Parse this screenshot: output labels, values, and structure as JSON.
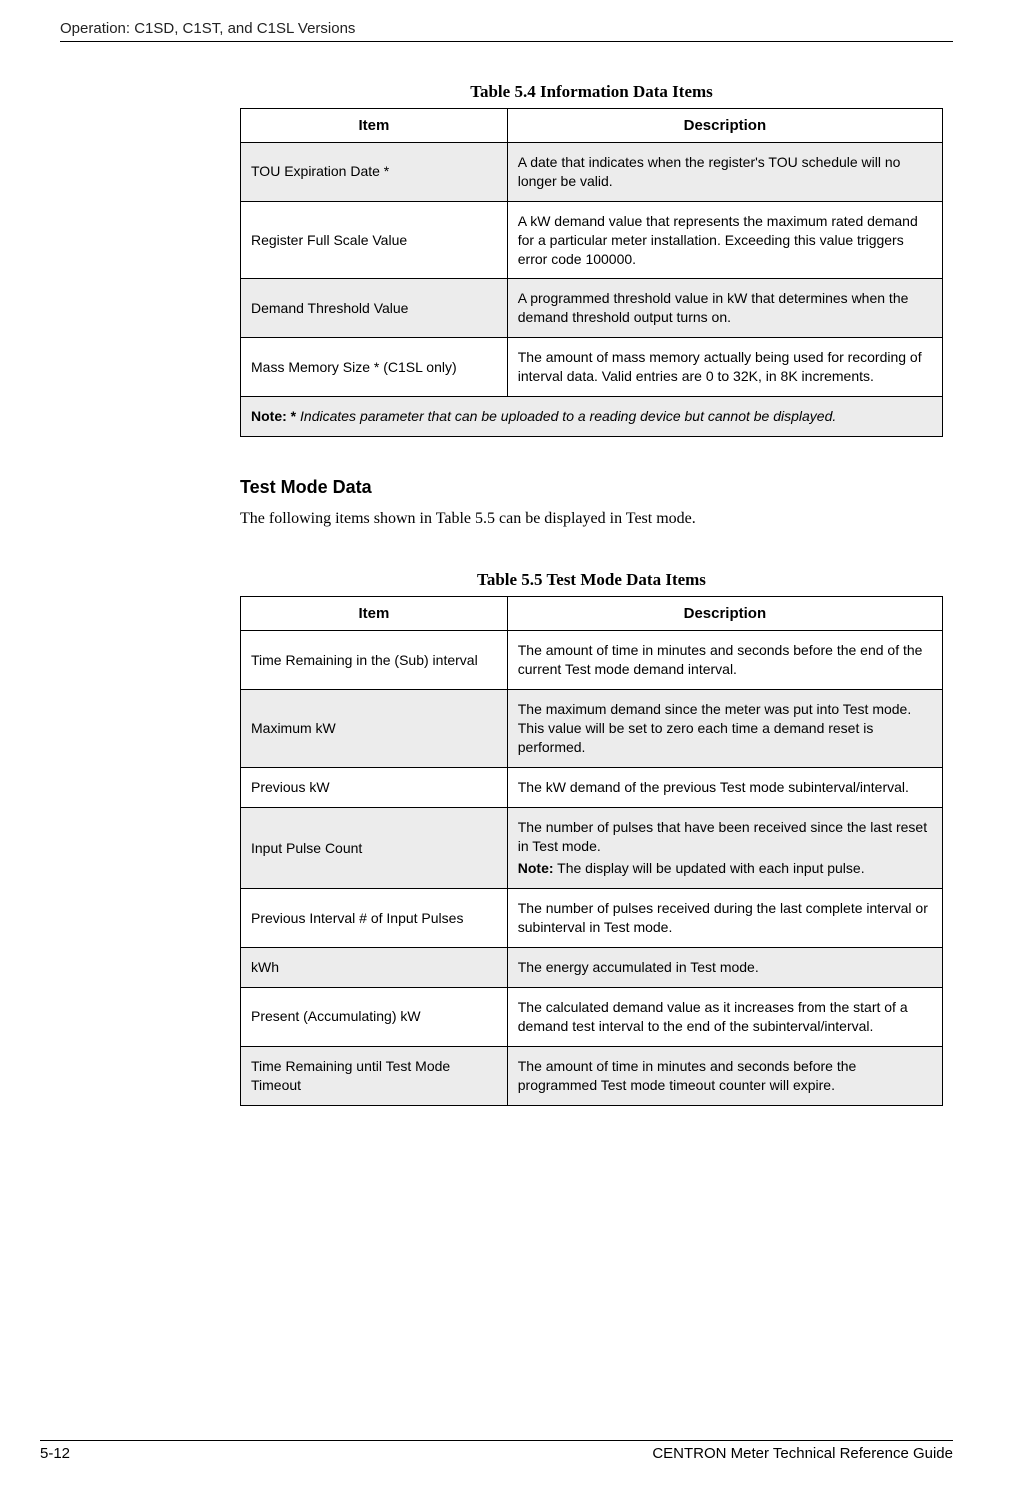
{
  "header": "Operation: C1SD, C1ST, and C1SL Versions",
  "table54": {
    "caption": "Table 5.4 Information Data Items",
    "headers": {
      "item": "Item",
      "desc": "Description"
    },
    "rows": [
      {
        "item": "TOU Expiration Date *",
        "desc": "A date that indicates when the register's TOU schedule will no longer be valid."
      },
      {
        "item": "Register Full Scale Value",
        "desc": "A kW demand value that represents the maximum rated demand for a particular meter installation. Exceeding this value triggers error code 100000."
      },
      {
        "item": "Demand Threshold Value",
        "desc": "A programmed threshold value in kW that determines when the demand threshold output turns on."
      },
      {
        "item": "Mass Memory Size * (C1SL only)",
        "desc": "The amount of mass memory actually being used for recording of interval data. Valid entries are 0 to 32K, in 8K increments."
      }
    ],
    "note_label": "Note: *",
    "note_text": " Indicates parameter that can be uploaded to a reading device but cannot be displayed."
  },
  "section": {
    "heading": "Test Mode Data",
    "body": "The following items shown in Table 5.5 can be displayed in Test mode."
  },
  "table55": {
    "caption": "Table 5.5 Test Mode Data Items",
    "headers": {
      "item": "Item",
      "desc": "Description"
    },
    "rows": [
      {
        "item": "Time Remaining in the (Sub) interval",
        "desc": "The amount of time in minutes and seconds before the end of the current Test mode demand interval."
      },
      {
        "item": "Maximum kW",
        "desc": "The maximum demand since the meter was put into Test mode. This value will be set to zero each time a demand reset is performed."
      },
      {
        "item": "Previous kW",
        "desc": "The kW demand of the previous Test mode subinterval/interval."
      },
      {
        "item": "Input Pulse Count",
        "desc": "The number of pulses that have been received since the last reset in Test mode.",
        "note_label": "Note:",
        "note_text": " The display will be updated with each input pulse."
      },
      {
        "item": "Previous Interval # of Input Pulses",
        "desc": "The number of pulses received during the last complete interval or subinterval in Test mode."
      },
      {
        "item": "kWh",
        "desc": "The energy accumulated in Test mode."
      },
      {
        "item": "Present (Accumulating) kW",
        "desc": "The calculated demand value as it increases from the start of a demand test interval to the end of the subinterval/interval."
      },
      {
        "item": "Time Remaining until Test Mode Timeout",
        "desc": "The amount of time in minutes and seconds before the programmed Test mode timeout counter will expire."
      }
    ]
  },
  "footer": {
    "left": "5-12",
    "right": "CENTRON Meter Technical Reference Guide"
  }
}
